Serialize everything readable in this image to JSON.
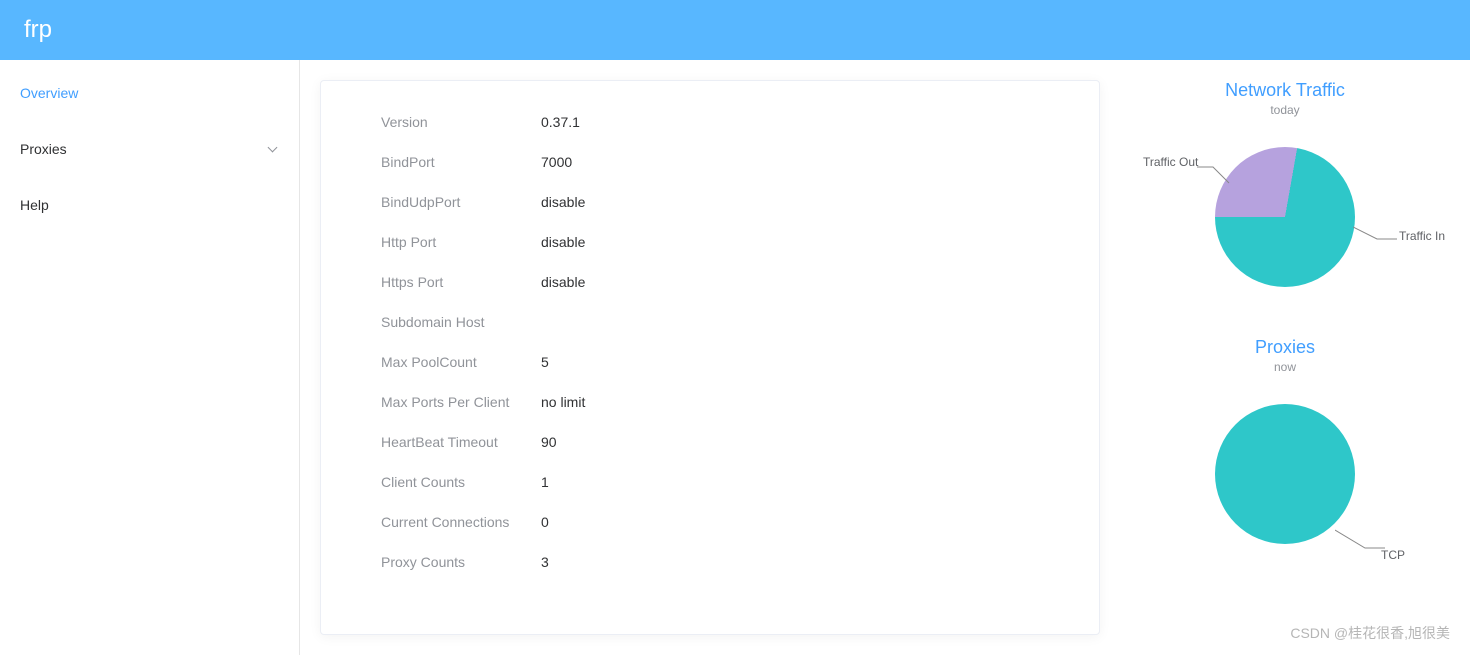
{
  "header": {
    "title": "frp"
  },
  "sidebar": {
    "overview": "Overview",
    "proxies": "Proxies",
    "help": "Help"
  },
  "form": {
    "rows": [
      {
        "label": "Version",
        "value": "0.37.1"
      },
      {
        "label": "BindPort",
        "value": "7000"
      },
      {
        "label": "BindUdpPort",
        "value": "disable"
      },
      {
        "label": "Http Port",
        "value": "disable"
      },
      {
        "label": "Https Port",
        "value": "disable"
      },
      {
        "label": "Subdomain Host",
        "value": ""
      },
      {
        "label": "Max PoolCount",
        "value": "5"
      },
      {
        "label": "Max Ports Per Client",
        "value": "no limit"
      },
      {
        "label": "HeartBeat Timeout",
        "value": "90"
      },
      {
        "label": "Client Counts",
        "value": "1"
      },
      {
        "label": "Current Connections",
        "value": "0"
      },
      {
        "label": "Proxy Counts",
        "value": "3"
      }
    ]
  },
  "charts": {
    "traffic": {
      "title": "Network Traffic",
      "subtitle": "today",
      "label_out": "Traffic Out",
      "label_in": "Traffic In"
    },
    "proxies": {
      "title": "Proxies",
      "subtitle": "now",
      "label_tcp": "TCP"
    }
  },
  "chart_data": [
    {
      "type": "pie",
      "title": "Network Traffic",
      "subtitle": "today",
      "series": [
        {
          "name": "Traffic Out",
          "value": 28,
          "color": "#b6a2de"
        },
        {
          "name": "Traffic In",
          "value": 72,
          "color": "#2ec7c9"
        }
      ]
    },
    {
      "type": "pie",
      "title": "Proxies",
      "subtitle": "now",
      "series": [
        {
          "name": "TCP",
          "value": 3,
          "color": "#2ec7c9"
        }
      ]
    }
  ],
  "watermark": "CSDN @桂花很香,旭很美"
}
